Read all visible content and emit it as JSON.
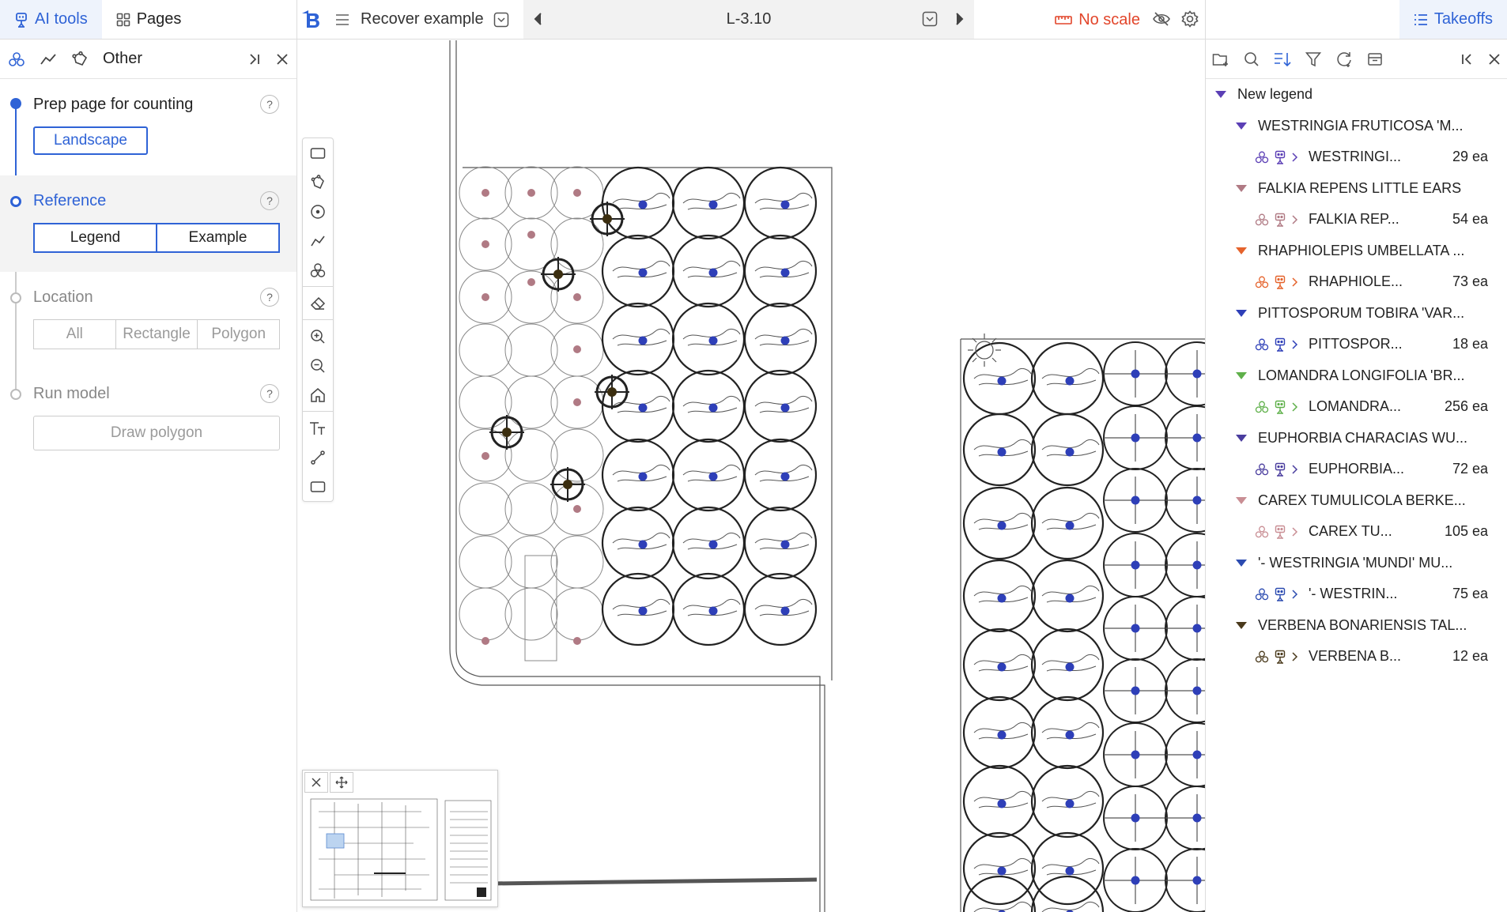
{
  "left_panel": {
    "tabs": [
      {
        "label": "AI tools",
        "icon": "robot-icon",
        "active": true
      },
      {
        "label": "Pages",
        "icon": "grid-icon",
        "active": false
      }
    ],
    "subheader": {
      "label": "Other"
    },
    "steps": [
      {
        "title": "Prep page for counting",
        "button": "Landscape",
        "state": "done"
      },
      {
        "title": "Reference",
        "options": [
          "Legend",
          "Example"
        ],
        "state": "active"
      },
      {
        "title": "Location",
        "options": [
          "All",
          "Rectangle",
          "Polygon"
        ],
        "state": "disabled"
      },
      {
        "title": "Run model",
        "button": "Draw polygon",
        "state": "disabled"
      }
    ],
    "help_label": "?"
  },
  "topbar": {
    "document_title": "Recover example",
    "page_label": "L-3.10",
    "scale_status": "No scale"
  },
  "right_panel": {
    "tab_label": "Takeoffs",
    "legend": {
      "name": "New legend",
      "groups": [
        {
          "title": "WESTRINGIA FRUTICOSA 'M...",
          "item": "WESTRINGI...",
          "count": "29 ea",
          "color": "#5b3fb5"
        },
        {
          "title": "FALKIA REPENS LITTLE EARS",
          "item": "FALKIA REP...",
          "count": "54 ea",
          "color": "#b07a84"
        },
        {
          "title": "RHAPHIOLEPIS UMBELLATA ...",
          "item": "RHAPHIOLE...",
          "count": "73 ea",
          "color": "#e5632c"
        },
        {
          "title": "PITTOSPORUM TOBIRA 'VAR...",
          "item": "PITTOSPOR...",
          "count": "18 ea",
          "color": "#2e3fb8"
        },
        {
          "title": "LOMANDRA LONGIFOLIA 'BR...",
          "item": "LOMANDRA...",
          "count": "256 ea",
          "color": "#5fb04a"
        },
        {
          "title": "EUPHORBIA CHARACIAS WU...",
          "item": "EUPHORBIA...",
          "count": "72 ea",
          "color": "#4a3d9e"
        },
        {
          "title": "CAREX TUMULICOLA BERKE...",
          "item": "CAREX TU...",
          "count": "105 ea",
          "color": "#c98e94"
        },
        {
          "title": "'- WESTRINGIA 'MUNDI' MU...",
          "item": "'- WESTRIN...",
          "count": "75 ea",
          "color": "#2b4bb0"
        },
        {
          "title": "VERBENA BONARIENSIS TAL...",
          "item": "VERBENA B...",
          "count": "12 ea",
          "color": "#4a3a1c"
        }
      ]
    }
  },
  "colors": {
    "accent": "#2f63d6",
    "warning": "#e2452a",
    "plan_dot_blue": "#2e3fb8",
    "plan_dot_pink": "#b07a84",
    "plan_marker": "#3b2e10"
  }
}
